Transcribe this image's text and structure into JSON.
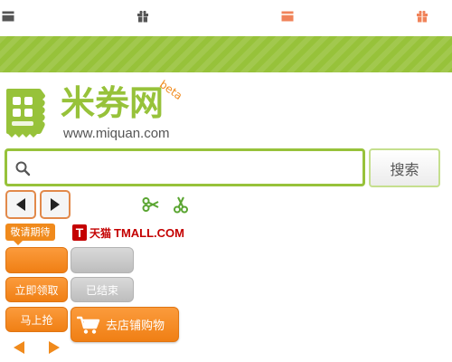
{
  "colors": {
    "brand_green": "#97c23a",
    "brand_orange": "#f08a1c",
    "tmall_red": "#c40000",
    "disabled_gray": "#c8c8c8"
  },
  "top_icons": [
    "card-icon",
    "gift-icon",
    "card-icon-active",
    "gift-icon-active"
  ],
  "logo": {
    "title": "米券网",
    "badge": "beta",
    "url": "www.miquan.com"
  },
  "search": {
    "value": "",
    "placeholder": "",
    "button_label": "搜索"
  },
  "tag": {
    "label": "敬请期待"
  },
  "tmall": {
    "badge": "T",
    "name_cn": "天猫",
    "name_en": "TMALL.COM"
  },
  "buttons": {
    "orange_blank": "",
    "gray_blank": "",
    "claim_now": "立即领取",
    "ended": "已结束",
    "grab_now": "马上抢",
    "go_shop": "去店铺购物"
  }
}
